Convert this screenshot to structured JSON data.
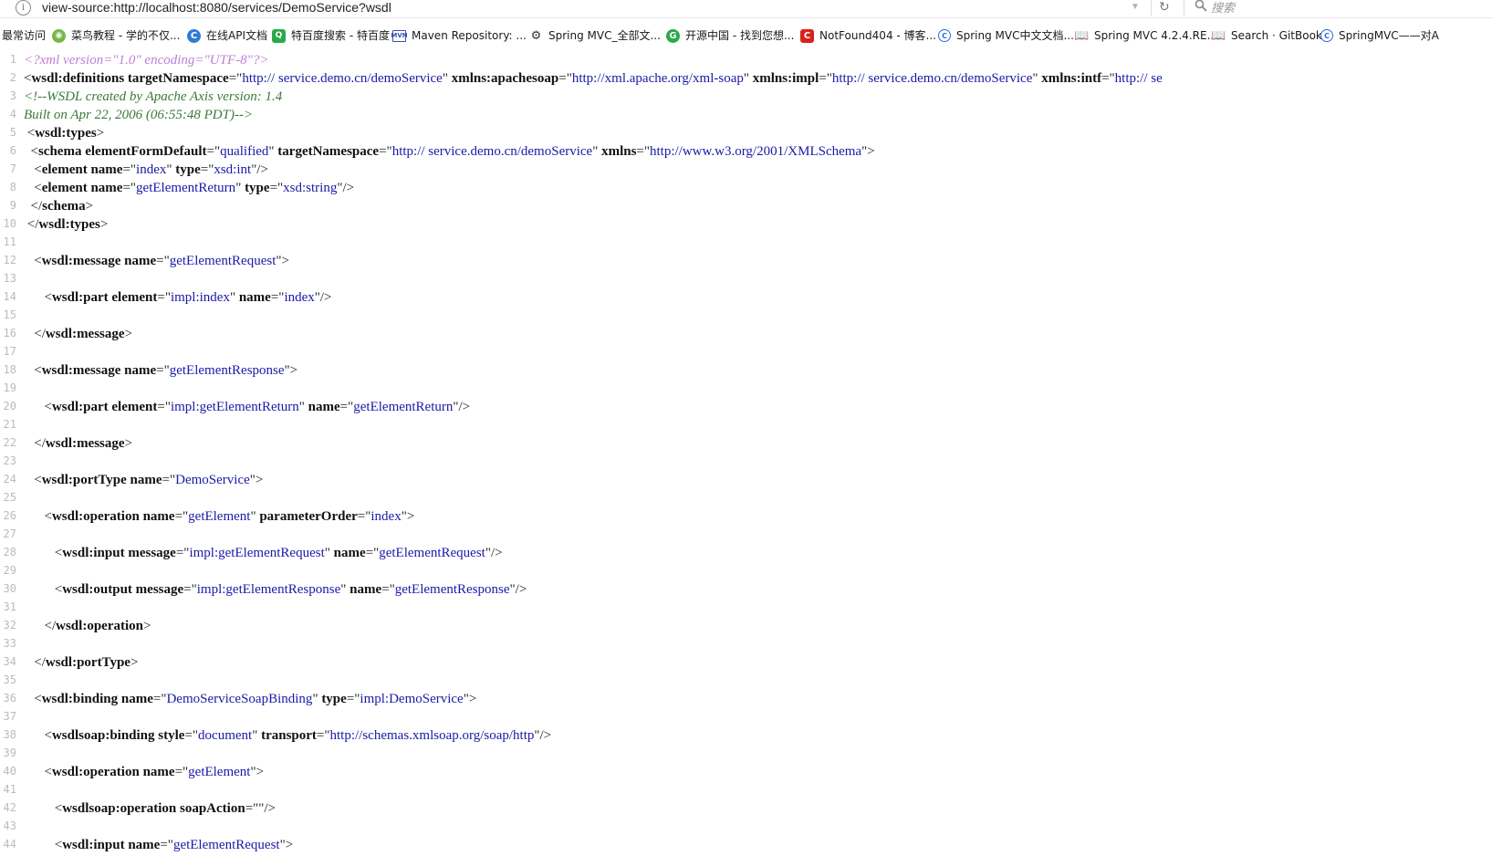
{
  "browser": {
    "url": "view-source:http://localhost:8080/services/DemoService?wsdl",
    "search_placeholder": "搜索"
  },
  "bookmarks": [
    {
      "label": "最常访问",
      "icon": "none"
    },
    {
      "label": "菜鸟教程 - 学的不仅...",
      "icon": "runoob-icon"
    },
    {
      "label": "在线API文档",
      "icon": "c-blue-icon"
    },
    {
      "label": "特百度搜索 - 特百度",
      "icon": "baidu-search-icon"
    },
    {
      "label": "Maven Repository: ...",
      "icon": "mvn-icon"
    },
    {
      "label": "Spring MVC_全部文...",
      "icon": "spring-icon"
    },
    {
      "label": "开源中国 - 找到您想...",
      "icon": "oschina-icon"
    },
    {
      "label": "NotFound404 - 博客...",
      "icon": "csdn-icon"
    },
    {
      "label": "Spring MVC中文文档...",
      "icon": "blue-c-icon"
    },
    {
      "label": "Spring MVC 4.2.4.RE...",
      "icon": "book-icon"
    },
    {
      "label": "Search · GitBook",
      "icon": "book-icon"
    },
    {
      "label": "SpringMVC——对A",
      "icon": "blue-c-icon"
    }
  ],
  "source_lines": [
    {
      "n": "1",
      "indent": "",
      "parts": [
        [
          "pi",
          "<?xml version=\"1.0\" encoding=\"UTF-8\"?>"
        ]
      ]
    },
    {
      "n": "2",
      "indent": "",
      "parts": [
        [
          "p",
          "<"
        ],
        [
          "tag",
          "wsdl:definitions"
        ],
        [
          "p",
          " "
        ],
        [
          "attr",
          "targetNamespace"
        ],
        [
          "p",
          "=\""
        ],
        [
          "val",
          "http:// service.demo.cn/demoService"
        ],
        [
          "p",
          "\" "
        ],
        [
          "attr",
          "xmlns:apachesoap"
        ],
        [
          "p",
          "=\""
        ],
        [
          "val",
          "http://xml.apache.org/xml-soap"
        ],
        [
          "p",
          "\" "
        ],
        [
          "attr",
          "xmlns:impl"
        ],
        [
          "p",
          "=\""
        ],
        [
          "val",
          "http:// service.demo.cn/demoService"
        ],
        [
          "p",
          "\" "
        ],
        [
          "attr",
          "xmlns:intf"
        ],
        [
          "p",
          "=\""
        ],
        [
          "val",
          "http:// se"
        ]
      ]
    },
    {
      "n": "3",
      "indent": "",
      "parts": [
        [
          "comment",
          "<!--WSDL created by Apache Axis version: 1.4"
        ]
      ]
    },
    {
      "n": "4",
      "indent": "",
      "parts": [
        [
          "comment",
          "Built on Apr 22, 2006 (06:55:48 PDT)-->"
        ]
      ]
    },
    {
      "n": "5",
      "indent": " ",
      "parts": [
        [
          "p",
          "<"
        ],
        [
          "tag",
          "wsdl:types"
        ],
        [
          "p",
          ">"
        ]
      ]
    },
    {
      "n": "6",
      "indent": "  ",
      "parts": [
        [
          "p",
          "<"
        ],
        [
          "tag",
          "schema"
        ],
        [
          "p",
          " "
        ],
        [
          "attr",
          "elementFormDefault"
        ],
        [
          "p",
          "=\""
        ],
        [
          "val",
          "qualified"
        ],
        [
          "p",
          "\" "
        ],
        [
          "attr",
          "targetNamespace"
        ],
        [
          "p",
          "=\""
        ],
        [
          "val",
          "http:// service.demo.cn/demoService"
        ],
        [
          "p",
          "\" "
        ],
        [
          "attr",
          "xmlns"
        ],
        [
          "p",
          "=\""
        ],
        [
          "val",
          "http://www.w3.org/2001/XMLSchema"
        ],
        [
          "p",
          "\">"
        ]
      ]
    },
    {
      "n": "7",
      "indent": "   ",
      "parts": [
        [
          "p",
          "<"
        ],
        [
          "tag",
          "element"
        ],
        [
          "p",
          " "
        ],
        [
          "attr",
          "name"
        ],
        [
          "p",
          "=\""
        ],
        [
          "val",
          "index"
        ],
        [
          "p",
          "\" "
        ],
        [
          "attr",
          "type"
        ],
        [
          "p",
          "=\""
        ],
        [
          "val",
          "xsd:int"
        ],
        [
          "p",
          "\"/>"
        ]
      ]
    },
    {
      "n": "8",
      "indent": "   ",
      "parts": [
        [
          "p",
          "<"
        ],
        [
          "tag",
          "element"
        ],
        [
          "p",
          " "
        ],
        [
          "attr",
          "name"
        ],
        [
          "p",
          "=\""
        ],
        [
          "val",
          "getElementReturn"
        ],
        [
          "p",
          "\" "
        ],
        [
          "attr",
          "type"
        ],
        [
          "p",
          "=\""
        ],
        [
          "val",
          "xsd:string"
        ],
        [
          "p",
          "\"/>"
        ]
      ]
    },
    {
      "n": "9",
      "indent": "  ",
      "parts": [
        [
          "p",
          "</"
        ],
        [
          "tag",
          "schema"
        ],
        [
          "p",
          ">"
        ]
      ]
    },
    {
      "n": "10",
      "indent": " ",
      "parts": [
        [
          "p",
          "</"
        ],
        [
          "tag",
          "wsdl:types"
        ],
        [
          "p",
          ">"
        ]
      ]
    },
    {
      "n": "11",
      "indent": "",
      "parts": []
    },
    {
      "n": "12",
      "indent": "   ",
      "parts": [
        [
          "p",
          "<"
        ],
        [
          "tag",
          "wsdl:message"
        ],
        [
          "p",
          " "
        ],
        [
          "attr",
          "name"
        ],
        [
          "p",
          "=\""
        ],
        [
          "val",
          "getElementRequest"
        ],
        [
          "p",
          "\">"
        ]
      ]
    },
    {
      "n": "13",
      "indent": "",
      "parts": []
    },
    {
      "n": "14",
      "indent": "      ",
      "parts": [
        [
          "p",
          "<"
        ],
        [
          "tag",
          "wsdl:part"
        ],
        [
          "p",
          " "
        ],
        [
          "attr",
          "element"
        ],
        [
          "p",
          "=\""
        ],
        [
          "val",
          "impl:index"
        ],
        [
          "p",
          "\" "
        ],
        [
          "attr",
          "name"
        ],
        [
          "p",
          "=\""
        ],
        [
          "val",
          "index"
        ],
        [
          "p",
          "\"/>"
        ]
      ]
    },
    {
      "n": "15",
      "indent": "",
      "parts": []
    },
    {
      "n": "16",
      "indent": "   ",
      "parts": [
        [
          "p",
          "</"
        ],
        [
          "tag",
          "wsdl:message"
        ],
        [
          "p",
          ">"
        ]
      ]
    },
    {
      "n": "17",
      "indent": "",
      "parts": []
    },
    {
      "n": "18",
      "indent": "   ",
      "parts": [
        [
          "p",
          "<"
        ],
        [
          "tag",
          "wsdl:message"
        ],
        [
          "p",
          " "
        ],
        [
          "attr",
          "name"
        ],
        [
          "p",
          "=\""
        ],
        [
          "val",
          "getElementResponse"
        ],
        [
          "p",
          "\">"
        ]
      ]
    },
    {
      "n": "19",
      "indent": "",
      "parts": []
    },
    {
      "n": "20",
      "indent": "      ",
      "parts": [
        [
          "p",
          "<"
        ],
        [
          "tag",
          "wsdl:part"
        ],
        [
          "p",
          " "
        ],
        [
          "attr",
          "element"
        ],
        [
          "p",
          "=\""
        ],
        [
          "val",
          "impl:getElementReturn"
        ],
        [
          "p",
          "\" "
        ],
        [
          "attr",
          "name"
        ],
        [
          "p",
          "=\""
        ],
        [
          "val",
          "getElementReturn"
        ],
        [
          "p",
          "\"/>"
        ]
      ]
    },
    {
      "n": "21",
      "indent": "",
      "parts": []
    },
    {
      "n": "22",
      "indent": "   ",
      "parts": [
        [
          "p",
          "</"
        ],
        [
          "tag",
          "wsdl:message"
        ],
        [
          "p",
          ">"
        ]
      ]
    },
    {
      "n": "23",
      "indent": "",
      "parts": []
    },
    {
      "n": "24",
      "indent": "   ",
      "parts": [
        [
          "p",
          "<"
        ],
        [
          "tag",
          "wsdl:portType"
        ],
        [
          "p",
          " "
        ],
        [
          "attr",
          "name"
        ],
        [
          "p",
          "=\""
        ],
        [
          "val",
          "DemoService"
        ],
        [
          "p",
          "\">"
        ]
      ]
    },
    {
      "n": "25",
      "indent": "",
      "parts": []
    },
    {
      "n": "26",
      "indent": "      ",
      "parts": [
        [
          "p",
          "<"
        ],
        [
          "tag",
          "wsdl:operation"
        ],
        [
          "p",
          " "
        ],
        [
          "attr",
          "name"
        ],
        [
          "p",
          "=\""
        ],
        [
          "val",
          "getElement"
        ],
        [
          "p",
          "\" "
        ],
        [
          "attr",
          "parameterOrder"
        ],
        [
          "p",
          "=\""
        ],
        [
          "val",
          "index"
        ],
        [
          "p",
          "\">"
        ]
      ]
    },
    {
      "n": "27",
      "indent": "",
      "parts": []
    },
    {
      "n": "28",
      "indent": "         ",
      "parts": [
        [
          "p",
          "<"
        ],
        [
          "tag",
          "wsdl:input"
        ],
        [
          "p",
          " "
        ],
        [
          "attr",
          "message"
        ],
        [
          "p",
          "=\""
        ],
        [
          "val",
          "impl:getElementRequest"
        ],
        [
          "p",
          "\" "
        ],
        [
          "attr",
          "name"
        ],
        [
          "p",
          "=\""
        ],
        [
          "val",
          "getElementRequest"
        ],
        [
          "p",
          "\"/>"
        ]
      ]
    },
    {
      "n": "29",
      "indent": "",
      "parts": []
    },
    {
      "n": "30",
      "indent": "         ",
      "parts": [
        [
          "p",
          "<"
        ],
        [
          "tag",
          "wsdl:output"
        ],
        [
          "p",
          " "
        ],
        [
          "attr",
          "message"
        ],
        [
          "p",
          "=\""
        ],
        [
          "val",
          "impl:getElementResponse"
        ],
        [
          "p",
          "\" "
        ],
        [
          "attr",
          "name"
        ],
        [
          "p",
          "=\""
        ],
        [
          "val",
          "getElementResponse"
        ],
        [
          "p",
          "\"/>"
        ]
      ]
    },
    {
      "n": "31",
      "indent": "",
      "parts": []
    },
    {
      "n": "32",
      "indent": "      ",
      "parts": [
        [
          "p",
          "</"
        ],
        [
          "tag",
          "wsdl:operation"
        ],
        [
          "p",
          ">"
        ]
      ]
    },
    {
      "n": "33",
      "indent": "",
      "parts": []
    },
    {
      "n": "34",
      "indent": "   ",
      "parts": [
        [
          "p",
          "</"
        ],
        [
          "tag",
          "wsdl:portType"
        ],
        [
          "p",
          ">"
        ]
      ]
    },
    {
      "n": "35",
      "indent": "",
      "parts": []
    },
    {
      "n": "36",
      "indent": "   ",
      "parts": [
        [
          "p",
          "<"
        ],
        [
          "tag",
          "wsdl:binding"
        ],
        [
          "p",
          " "
        ],
        [
          "attr",
          "name"
        ],
        [
          "p",
          "=\""
        ],
        [
          "val",
          "DemoServiceSoapBinding"
        ],
        [
          "p",
          "\" "
        ],
        [
          "attr",
          "type"
        ],
        [
          "p",
          "=\""
        ],
        [
          "val",
          "impl:DemoService"
        ],
        [
          "p",
          "\">"
        ]
      ]
    },
    {
      "n": "37",
      "indent": "",
      "parts": []
    },
    {
      "n": "38",
      "indent": "      ",
      "parts": [
        [
          "p",
          "<"
        ],
        [
          "tag",
          "wsdlsoap:binding"
        ],
        [
          "p",
          " "
        ],
        [
          "attr",
          "style"
        ],
        [
          "p",
          "=\""
        ],
        [
          "val",
          "document"
        ],
        [
          "p",
          "\" "
        ],
        [
          "attr",
          "transport"
        ],
        [
          "p",
          "=\""
        ],
        [
          "val",
          "http://schemas.xmlsoap.org/soap/http"
        ],
        [
          "p",
          "\"/>"
        ]
      ]
    },
    {
      "n": "39",
      "indent": "",
      "parts": []
    },
    {
      "n": "40",
      "indent": "      ",
      "parts": [
        [
          "p",
          "<"
        ],
        [
          "tag",
          "wsdl:operation"
        ],
        [
          "p",
          " "
        ],
        [
          "attr",
          "name"
        ],
        [
          "p",
          "=\""
        ],
        [
          "val",
          "getElement"
        ],
        [
          "p",
          "\">"
        ]
      ]
    },
    {
      "n": "41",
      "indent": "",
      "parts": []
    },
    {
      "n": "42",
      "indent": "         ",
      "parts": [
        [
          "p",
          "<"
        ],
        [
          "tag",
          "wsdlsoap:operation"
        ],
        [
          "p",
          " "
        ],
        [
          "attr",
          "soapAction"
        ],
        [
          "p",
          "=\"\"/>"
        ]
      ]
    },
    {
      "n": "43",
      "indent": "",
      "parts": []
    },
    {
      "n": "44",
      "indent": "         ",
      "parts": [
        [
          "p",
          "<"
        ],
        [
          "tag",
          "wsdl:input"
        ],
        [
          "p",
          " "
        ],
        [
          "attr",
          "name"
        ],
        [
          "p",
          "=\""
        ],
        [
          "val",
          "getElementRequest"
        ],
        [
          "p",
          "\">"
        ]
      ]
    }
  ]
}
